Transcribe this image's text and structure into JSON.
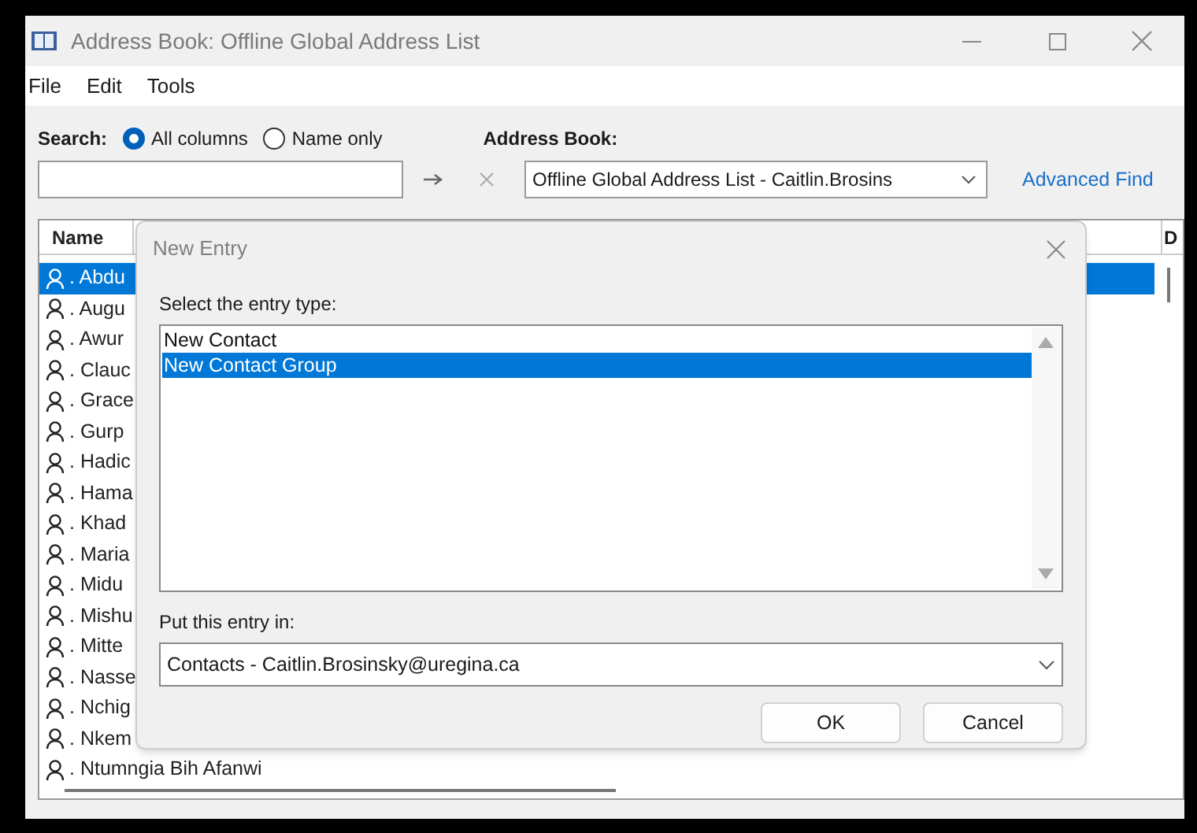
{
  "window": {
    "title": "Address Book: Offline Global Address List"
  },
  "menu": [
    "File",
    "Edit",
    "Tools"
  ],
  "search": {
    "label": "Search:",
    "options": [
      {
        "label": "All columns",
        "selected": true
      },
      {
        "label": "Name only",
        "selected": false
      }
    ]
  },
  "address_book": {
    "label": "Address Book:",
    "value": "Offline Global Address List - Caitlin.Brosins",
    "link": "Advanced Find"
  },
  "table": {
    "columns": [
      "Name",
      "D"
    ],
    "rows": [
      {
        "name": ". Abdu",
        "selected": true
      },
      {
        "name": ". Augu",
        "selected": false
      },
      {
        "name": ". Awur",
        "selected": false
      },
      {
        "name": ". Clauc",
        "selected": false
      },
      {
        "name": ". Grace",
        "selected": false
      },
      {
        "name": ". Gurp",
        "selected": false
      },
      {
        "name": ". Hadic",
        "selected": false
      },
      {
        "name": ". Hama",
        "selected": false
      },
      {
        "name": ". Khad",
        "selected": false
      },
      {
        "name": ". Maria",
        "selected": false
      },
      {
        "name": ". Midu",
        "selected": false
      },
      {
        "name": ". Mishu",
        "selected": false
      },
      {
        "name": ". Mitte",
        "selected": false
      },
      {
        "name": ". Nasse",
        "selected": false
      },
      {
        "name": ". Nchig",
        "selected": false
      },
      {
        "name": ". Nkem",
        "selected": false
      },
      {
        "name": ". Ntumngia Bih Afanwi",
        "selected": false
      }
    ]
  },
  "dialog": {
    "title": "New Entry",
    "prompt": "Select the entry type:",
    "entry_types": [
      {
        "label": "New Contact",
        "selected": false
      },
      {
        "label": "New Contact Group",
        "selected": true
      }
    ],
    "location_label": "Put this entry in:",
    "location_value": "Contacts - Caitlin.Brosinsky@uregina.ca",
    "buttons": [
      "OK",
      "Cancel"
    ]
  }
}
